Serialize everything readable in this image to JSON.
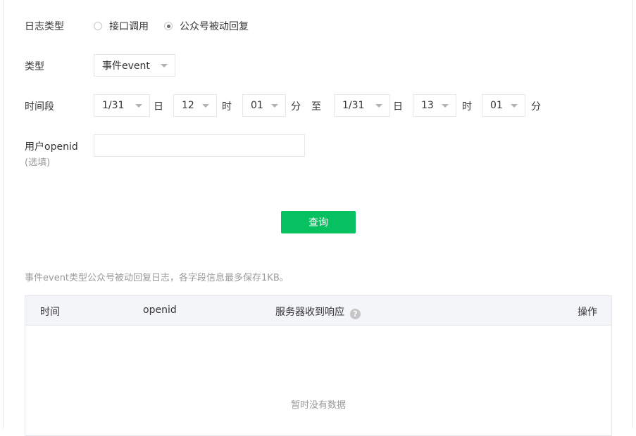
{
  "form": {
    "log_type": {
      "label": "日志类型",
      "options": [
        {
          "label": "接口调用",
          "checked": false
        },
        {
          "label": "公众号被动回复",
          "checked": true
        }
      ]
    },
    "type": {
      "label": "类型",
      "value": "事件event"
    },
    "time_range": {
      "label": "时间段",
      "start": {
        "date": "1/31",
        "date_unit": "日",
        "hour": "12",
        "hour_unit": "时",
        "minute": "01",
        "minute_unit": "分"
      },
      "to": "至",
      "end": {
        "date": "1/31",
        "date_unit": "日",
        "hour": "13",
        "hour_unit": "时",
        "minute": "01",
        "minute_unit": "分"
      }
    },
    "openid": {
      "label": "用户openid",
      "sublabel": "(选填)",
      "value": ""
    },
    "query_button": "查询"
  },
  "note": "事件event类型公众号被动回复日志，各字段信息最多保存1KB。",
  "table": {
    "columns": [
      "时间",
      "openid",
      "服务器收到响应",
      "操作"
    ],
    "help_icon": "?",
    "empty_text": "暂时没有数据",
    "rows": []
  },
  "colors": {
    "accent": "#07c160"
  }
}
